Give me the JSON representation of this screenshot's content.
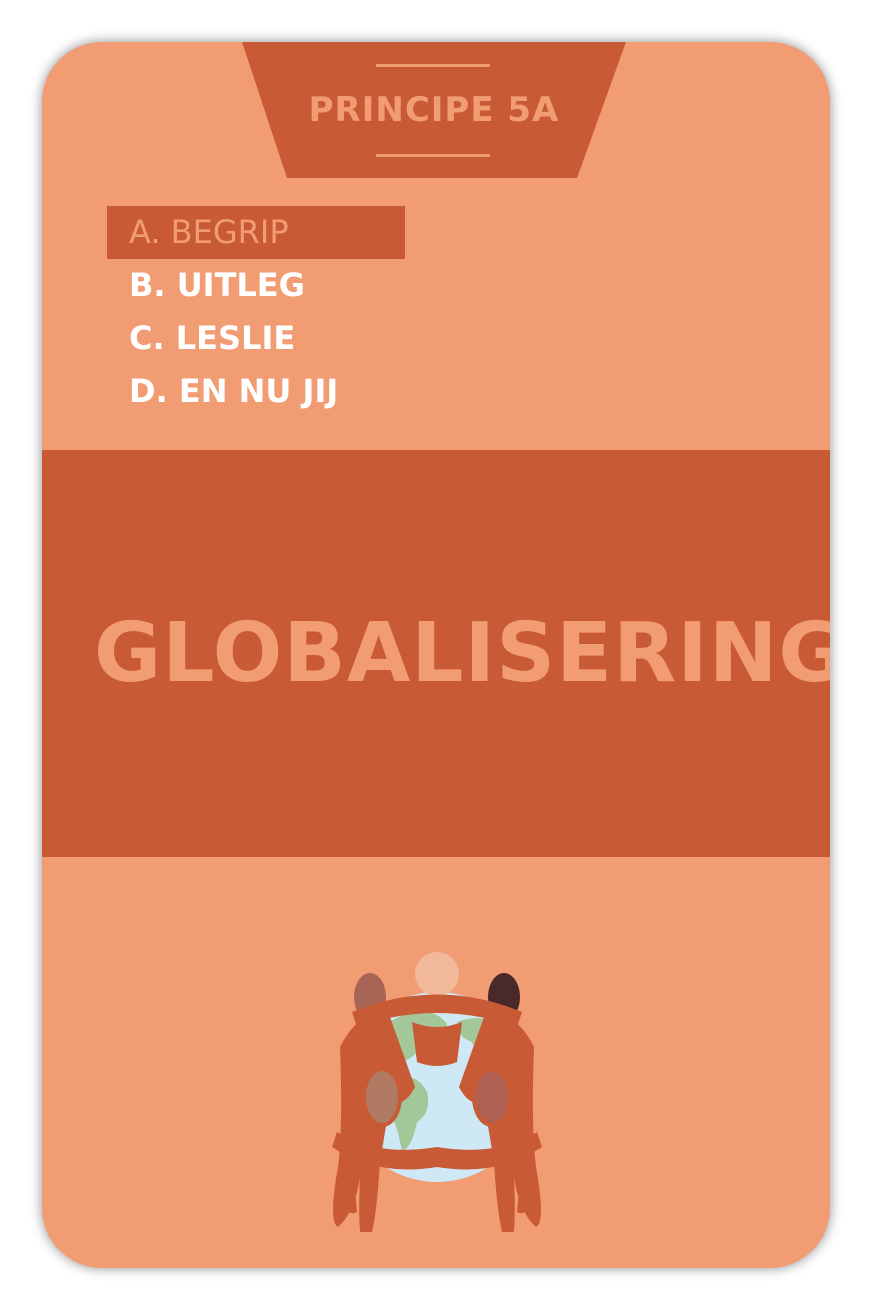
{
  "card": {
    "principle_label": "PRINCIPE 5A",
    "menu": [
      {
        "label": "A. BEGRIP",
        "active": true
      },
      {
        "label": "B. UITLEG",
        "active": false
      },
      {
        "label": "C. LESLIE",
        "active": false
      },
      {
        "label": "D. EN NU JIJ",
        "active": false
      }
    ],
    "title": "GLOBALISERING",
    "illustration_icon": "people-around-globe-icon"
  },
  "colors": {
    "card_background": "#f29c73",
    "accent": "#c95a36",
    "menu_text": "#ffffff"
  }
}
